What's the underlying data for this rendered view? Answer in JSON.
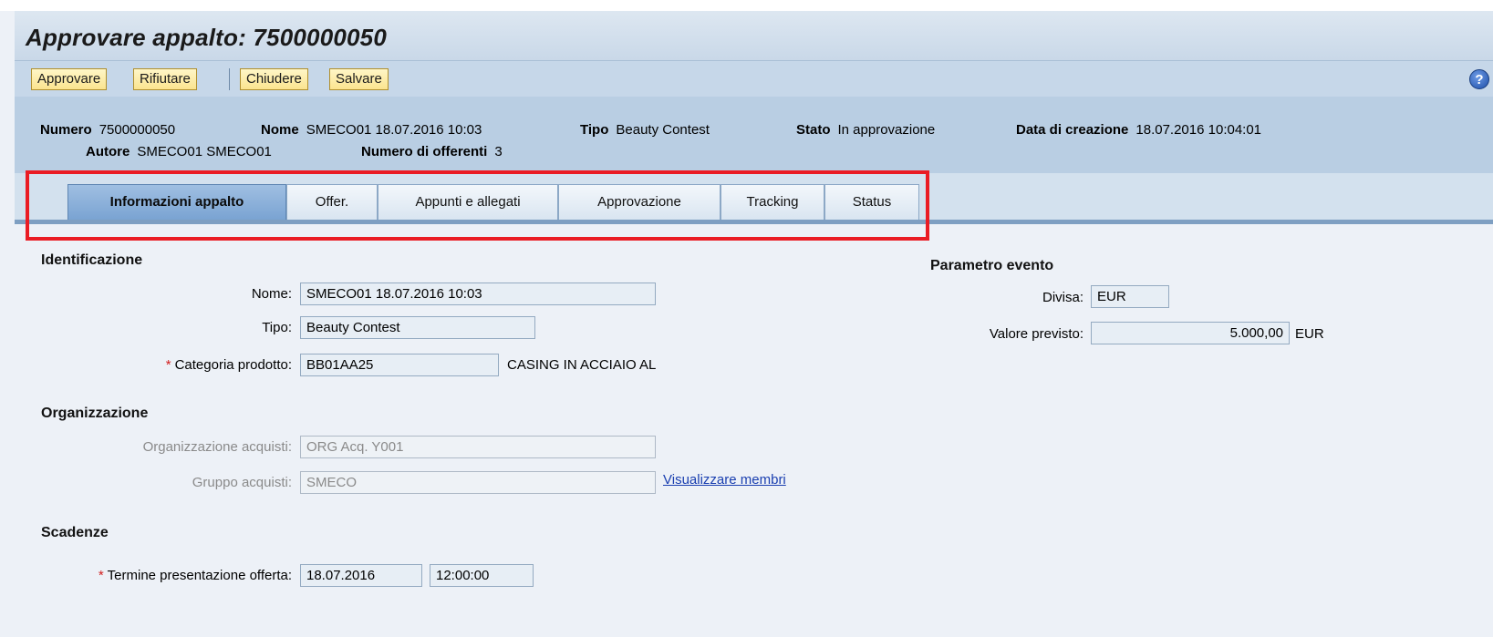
{
  "title": "Approvare appalto: 7500000050",
  "toolbar": {
    "approve": "Approvare",
    "reject": "Rifiutare",
    "close": "Chiudere",
    "save": "Salvare",
    "help_icon": "help-icon",
    "help_glyph": "?"
  },
  "header": {
    "numero_label": "Numero",
    "numero_value": "7500000050",
    "nome_label": "Nome",
    "nome_value": "SMECO01 18.07.2016 10:03",
    "tipo_label": "Tipo",
    "tipo_value": "Beauty Contest",
    "stato_label": "Stato",
    "stato_value": "In approvazione",
    "data_label": "Data di creazione",
    "data_value": "18.07.2016 10:04:01",
    "autore_label": "Autore",
    "autore_value": "SMECO01 SMECO01",
    "offerenti_label": "Numero di offerenti",
    "offerenti_value": "3"
  },
  "tabs": [
    {
      "label": "Informazioni appalto",
      "active": true
    },
    {
      "label": "Offer.",
      "active": false
    },
    {
      "label": "Appunti e allegati",
      "active": false
    },
    {
      "label": "Approvazione",
      "active": false
    },
    {
      "label": "Tracking",
      "active": false
    },
    {
      "label": "Status",
      "active": false
    }
  ],
  "identificazione": {
    "title": "Identificazione",
    "nome_label": "Nome:",
    "nome_value": "SMECO01 18.07.2016 10:03",
    "tipo_label": "Tipo:",
    "tipo_value": "Beauty Contest",
    "categoria_required": "*",
    "categoria_label": "Categoria prodotto:",
    "categoria_value": "BB01AA25",
    "categoria_desc": "CASING IN ACCIAIO AL"
  },
  "organizzazione": {
    "title": "Organizzazione",
    "org_label": "Organizzazione acquisti:",
    "org_value": "ORG Acq. Y001",
    "gruppo_label": "Gruppo acquisti:",
    "gruppo_value": "SMECO",
    "membri_link": "Visualizzare membri"
  },
  "scadenze": {
    "title": "Scadenze",
    "termine_required": "*",
    "termine_label": "Termine presentazione offerta:",
    "termine_date": "18.07.2016",
    "termine_time": "12:00:00"
  },
  "parametro": {
    "title": "Parametro evento",
    "divisa_label": "Divisa:",
    "divisa_value": "EUR",
    "valore_label": "Valore previsto:",
    "valore_value": "5.000,00",
    "valore_unit": "EUR"
  },
  "colors": {
    "accent_highlight": "#ea1c24",
    "button_face": "#fbe48f",
    "header_bg": "#b9cee3",
    "active_tab": "#7aa3d2"
  }
}
